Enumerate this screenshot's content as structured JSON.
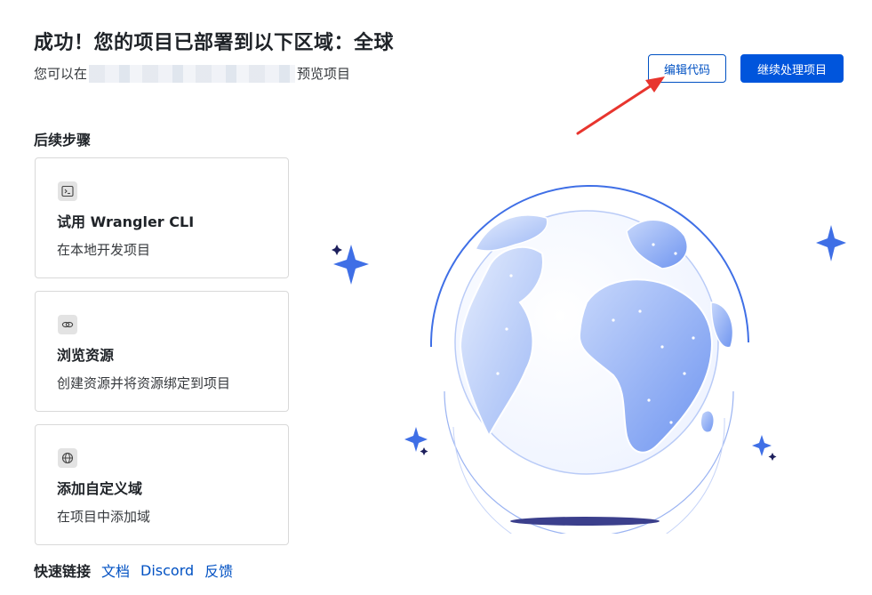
{
  "header": {
    "title": "成功！您的项目已部署到以下区域：全球",
    "subtitle_prefix": "您可以在",
    "subtitle_suffix": "预览项目"
  },
  "actions": {
    "edit_code": "编辑代码",
    "continue": "继续处理项目"
  },
  "next_steps": {
    "title": "后续步骤",
    "cards": [
      {
        "icon": "terminal-icon",
        "title": "试用 Wrangler CLI",
        "desc": "在本地开发项目"
      },
      {
        "icon": "link-icon",
        "title": "浏览资源",
        "desc": "创建资源并将资源绑定到项目"
      },
      {
        "icon": "globe-icon",
        "title": "添加自定义域",
        "desc": "在项目中添加域"
      }
    ]
  },
  "quick_links": {
    "label": "快速链接",
    "links": [
      "文档",
      "Discord",
      "反馈"
    ]
  },
  "colors": {
    "primary": "#0055dc",
    "link": "#0051c3",
    "arrow": "#e8352e",
    "globe_fill": "#8fb0f7"
  }
}
